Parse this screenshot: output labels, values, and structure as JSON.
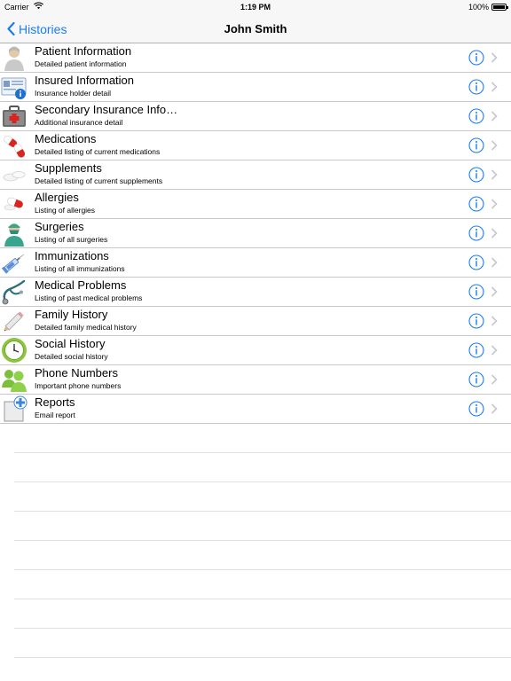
{
  "status_bar": {
    "carrier": "Carrier",
    "time": "1:19 PM",
    "battery": "100%"
  },
  "nav": {
    "back_label": "Histories",
    "title": "John Smith"
  },
  "colors": {
    "accent": "#1a7cf5",
    "chevron": "#c7c7cc"
  },
  "items": [
    {
      "label": "Patient Information",
      "sub": "Detailed patient information",
      "icon": "patient-icon"
    },
    {
      "label": "Insured Information",
      "sub": "Insurance holder detail",
      "icon": "insurance-card-icon"
    },
    {
      "label": "Secondary Insurance Info…",
      "sub": "Additional insurance detail",
      "icon": "medical-kit-icon"
    },
    {
      "label": "Medications",
      "sub": "Detailed listing of current medications",
      "icon": "pills-icon"
    },
    {
      "label": "Supplements",
      "sub": "Detailed listing of current supplements",
      "icon": "tablets-icon"
    },
    {
      "label": "Allergies",
      "sub": "Listing of allergies",
      "icon": "capsule-icon"
    },
    {
      "label": "Surgeries",
      "sub": "Listing of all surgeries",
      "icon": "surgeon-icon"
    },
    {
      "label": "Immunizations",
      "sub": "Listing of all immunizations",
      "icon": "syringe-icon"
    },
    {
      "label": "Medical Problems",
      "sub": "Listing of past medical problems",
      "icon": "stethoscope-icon"
    },
    {
      "label": "Family History",
      "sub": "Detailed family medical history",
      "icon": "pencil-icon"
    },
    {
      "label": "Social History",
      "sub": "Detailed social history",
      "icon": "clock-icon"
    },
    {
      "label": "Phone Numbers",
      "sub": "Important phone numbers",
      "icon": "people-icon"
    },
    {
      "label": "Reports",
      "sub": "Email report",
      "icon": "report-icon"
    }
  ]
}
